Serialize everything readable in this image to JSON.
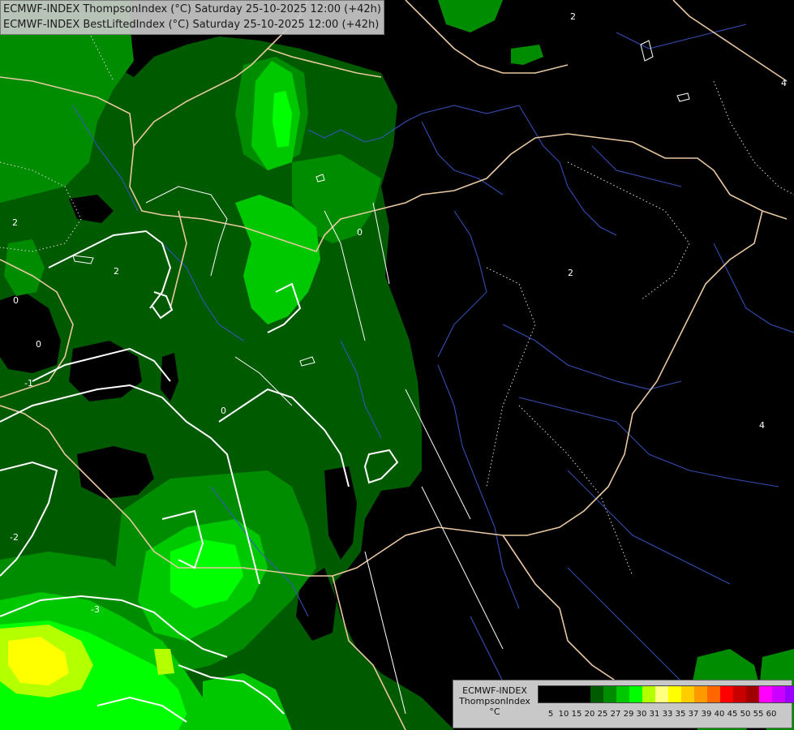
{
  "header": {
    "line1": "ECMWF-INDEX ThompsonIndex (°C) Saturday 25-10-2025 12:00 (+42h)",
    "line2": "ECMWF-INDEX BestLiftedIndex (°C) Saturday 25-10-2025 12:00 (+42h)"
  },
  "legend": {
    "title_line1": "ECMWF-INDEX",
    "title_line2": "ThompsonIndex",
    "title_line3": "°C",
    "colors": [
      "#000000",
      "#000000",
      "#000000",
      "#000000",
      "#005a00",
      "#008c00",
      "#00c800",
      "#00ff00",
      "#b4ff00",
      "#ffff80",
      "#ffff00",
      "#ffcc00",
      "#ff9900",
      "#ff6600",
      "#ff0000",
      "#c80000",
      "#a00000",
      "#ff00ff",
      "#cc00ff",
      "#9900ff",
      "#6600ff",
      "#0000ff"
    ],
    "ticks": [
      "5",
      "10",
      "15",
      "20",
      "25",
      "27",
      "29",
      "30",
      "31",
      "33",
      "35",
      "37",
      "39",
      "40",
      "45",
      "50",
      "55",
      "60"
    ]
  },
  "contour_labels": [
    "2",
    "0",
    "2",
    "0",
    "-1",
    "0",
    "0",
    "2",
    "2",
    "4",
    "4",
    "-2",
    "-3",
    "2"
  ],
  "palette": {
    "green_dark": "#005a00",
    "green_mid": "#008c00",
    "green_bright": "#00c800",
    "green_lime": "#00ff00",
    "yellow_green": "#b4ff00",
    "yellow": "#ffff00",
    "border": "#e8c8a0",
    "rivers": "#3a55c8",
    "isoline": "#ffffff"
  }
}
